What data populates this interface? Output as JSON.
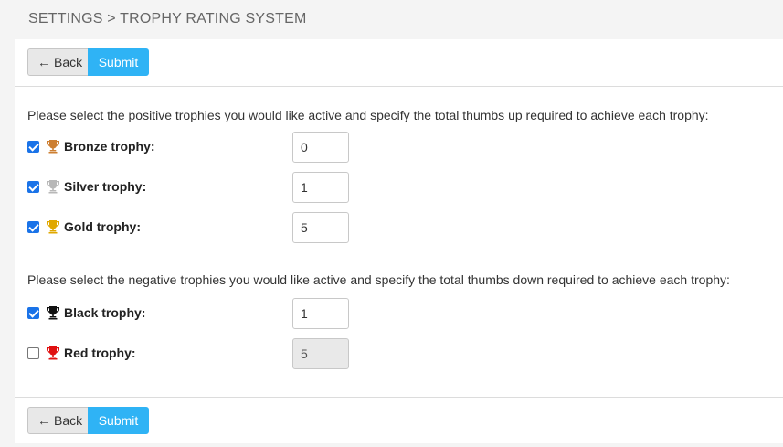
{
  "header": {
    "title": "SETTINGS > TROPHY RATING SYSTEM"
  },
  "toolbar": {
    "back_label": "Back",
    "back_arrow": "←",
    "submit_label": "Submit"
  },
  "positive": {
    "intro": "Please select the positive trophies you would like active and specify the total thumbs up required to achieve each trophy:",
    "trophies": [
      {
        "label": "Bronze trophy:",
        "checked": true,
        "value": "0",
        "color": "#cd7f32",
        "icon": "trophy-icon"
      },
      {
        "label": "Silver trophy:",
        "checked": true,
        "value": "1",
        "color": "#b8b8b8",
        "icon": "trophy-icon"
      },
      {
        "label": "Gold trophy:",
        "checked": true,
        "value": "5",
        "color": "#e0a800",
        "icon": "trophy-icon"
      }
    ]
  },
  "negative": {
    "intro": "Please select the negative trophies you would like active and specify the total thumbs down required to achieve each trophy:",
    "trophies": [
      {
        "label": "Black trophy:",
        "checked": true,
        "value": "1",
        "color": "#111111",
        "icon": "trophy-icon"
      },
      {
        "label": "Red trophy:",
        "checked": false,
        "value": "5",
        "color": "#e01010",
        "icon": "trophy-icon",
        "disabled": true
      }
    ]
  },
  "colors": {
    "accent": "#2fb3f5",
    "checkbox": "#1a73e8"
  }
}
